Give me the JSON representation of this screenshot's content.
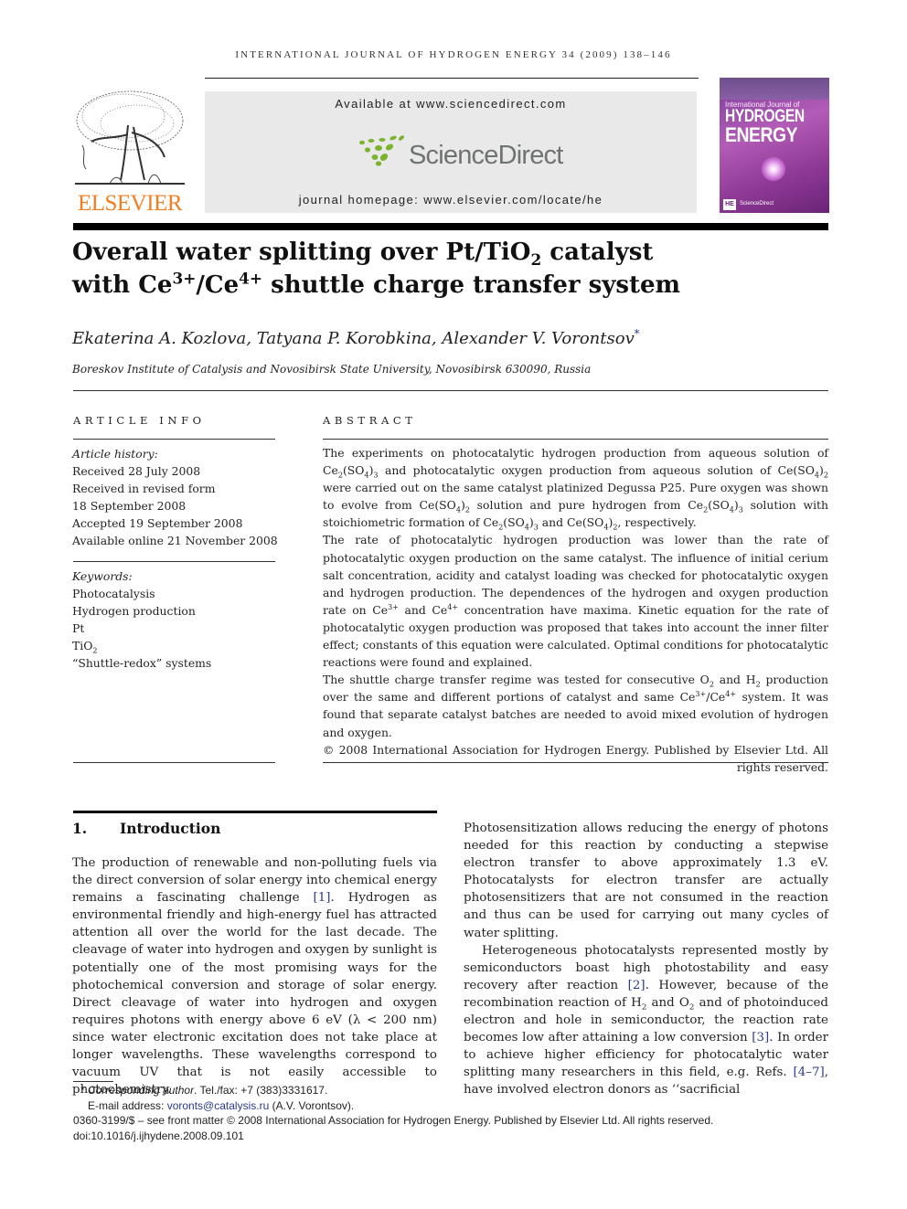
{
  "running_head": "INTERNATIONAL JOURNAL OF HYDROGEN ENERGY 34 (2009) 138–146",
  "masthead": {
    "publisher_logo_text": "ELSEVIER",
    "available_at": "Available at www.sciencedirect.com",
    "sciencedirect_name": "ScienceDirect",
    "journal_homepage": "journal homepage: www.elsevier.com/locate/he",
    "cover": {
      "small_title": "International Journal of",
      "big_title_1": "HYDROGEN",
      "big_title_2": "ENERGY",
      "badge": "HE",
      "footer": "ScienceDirect"
    },
    "colors": {
      "elsevier_orange": "#f57c1f",
      "sciencedirect_green": "#7bb32e",
      "sciencedirect_gray": "#6f7470",
      "masthead_bg": "#e9e9e9"
    }
  },
  "article": {
    "title_line1_pre": "Overall water splitting over Pt/TiO",
    "title_line1_sub": "2",
    "title_line1_post": " catalyst",
    "title_line2_a": "with Ce",
    "title_line2_sup1": "3+",
    "title_line2_b": "/Ce",
    "title_line2_sup2": "4+",
    "title_line2_c": " shuttle charge transfer system",
    "authors": "Ekaterina A. Kozlova, Tatyana P. Korobkina, Alexander V. Vorontsov",
    "author_marker": "*",
    "affiliation": "Boreskov Institute of Catalysis and Novosibirsk State University, Novosibirsk 630090, Russia"
  },
  "article_info": {
    "label": "ARTICLE INFO",
    "history_label": "Article history:",
    "history": [
      "Received 28 July 2008",
      "Received in revised form",
      "18 September 2008",
      "Accepted 19 September 2008",
      "Available online 21 November 2008"
    ],
    "keywords_label": "Keywords:",
    "keywords": [
      "Photocatalysis",
      "Hydrogen production",
      "Pt",
      "TiO",
      "“Shuttle-redox” systems"
    ],
    "keyword_tio2_sub": "2"
  },
  "abstract": {
    "label": "ABSTRACT",
    "p1": {
      "a": "The experiments on photocatalytic hydrogen production from aqueous solution of Ce",
      "b": "(SO",
      "c": ")",
      "d": " and photocatalytic oxygen production from aqueous solution of Ce(SO",
      "e": ")",
      "f": " were carried out on the same catalyst platinized Degussa P25. Pure oxygen was shown to evolve from Ce(SO",
      "g": ")",
      "h": " solution and pure hydrogen from Ce",
      "i": "(SO",
      "j": ")",
      "k": " solution with stoichiometric formation of Ce",
      "l": "(SO",
      "m": ")",
      "n": " and Ce(SO",
      "o": ")",
      "p": ", respectively."
    },
    "p2_a": "The rate of photocatalytic hydrogen production was lower than the rate of photocatalytic oxygen production on the same catalyst. The influence of initial cerium salt concentration, acidity and catalyst loading was checked for photocatalytic oxygen and hydrogen production. The dependences of the hydrogen and oxygen production rate on Ce",
    "p2_b": " and Ce",
    "p2_c": " concentration have maxima. Kinetic equation for the rate of photocatalytic oxygen production was proposed that takes into account the inner filter effect; constants of this equation were calculated. Optimal conditions for photocatalytic reactions were found and explained.",
    "p3_a": "The shuttle charge transfer regime was tested for consecutive O",
    "p3_b": " and H",
    "p3_c": " production over the same and different portions of catalyst and same Ce",
    "p3_d": "/Ce",
    "p3_e": " system. It was found that separate catalyst batches are needed to avoid mixed evolution of hydrogen and oxygen.",
    "copyright": "© 2008 International Association for Hydrogen Energy. Published by Elsevier Ltd. All rights reserved.",
    "sub2": "2",
    "sub3": "3",
    "sub4": "4",
    "sup3": "3+",
    "sup4": "4+"
  },
  "introduction": {
    "number": "1.",
    "heading": "Introduction",
    "left_p1_a": "The production of renewable and non-polluting fuels via the direct conversion of solar energy into chemical energy remains a fascinating challenge ",
    "ref1": "[1]",
    "left_p1_b": ". Hydrogen as environmental friendly and high-energy fuel has attracted attention all over the world for the last decade. The cleavage of water into hydrogen and oxygen by sunlight is potentially one of the most promising ways for the photochemical conversion and storage of solar energy. Direct cleavage of water into hydrogen and oxygen requires photons with energy above 6 eV (λ < 200 nm) since water electronic excitation does not take place at longer wavelengths. These wavelengths correspond to vacuum UV that is not easily accessible to photochemistry.",
    "right_p1": "Photosensitization allows reducing the energy of photons needed for this reaction by conducting a stepwise electron transfer to above approximately 1.3 eV. Photocatalysts for electron transfer are actually photosensitizers that are not consumed in the reaction and thus can be used for carrying out many cycles of water splitting.",
    "right_p2_a": "Heterogeneous photocatalysts represented mostly by semiconductors boast high photostability and easy recovery after reaction ",
    "ref2": "[2]",
    "right_p2_b": ". However, because of the recombination reaction of H",
    "right_p2_c": " and O",
    "right_p2_d": " and of photoinduced electron and hole in semiconductor, the reaction rate becomes low after attaining a low conversion ",
    "ref3": "[3]",
    "right_p2_e": ". In order to achieve higher efficiency for photocatalytic water splitting many researchers in this field, e.g. Refs. ",
    "ref4_7": "[4–7]",
    "right_p2_f": ", have involved electron donors as ‘‘sacrificial",
    "sub2": "2"
  },
  "footnotes": {
    "marker": "*",
    "corresponding_label": "Corresponding author",
    "corresponding_rest": ". Tel./fax: +7 (383)3331617.",
    "email_label": "E-mail address: ",
    "email": "voronts@catalysis.ru",
    "email_rest": " (A.V. Vorontsov).",
    "front_matter": "0360-3199/$ – see front matter © 2008 International Association for Hydrogen Energy. Published by Elsevier Ltd. All rights reserved.",
    "doi": "doi:10.1016/j.ijhydene.2008.09.101"
  }
}
